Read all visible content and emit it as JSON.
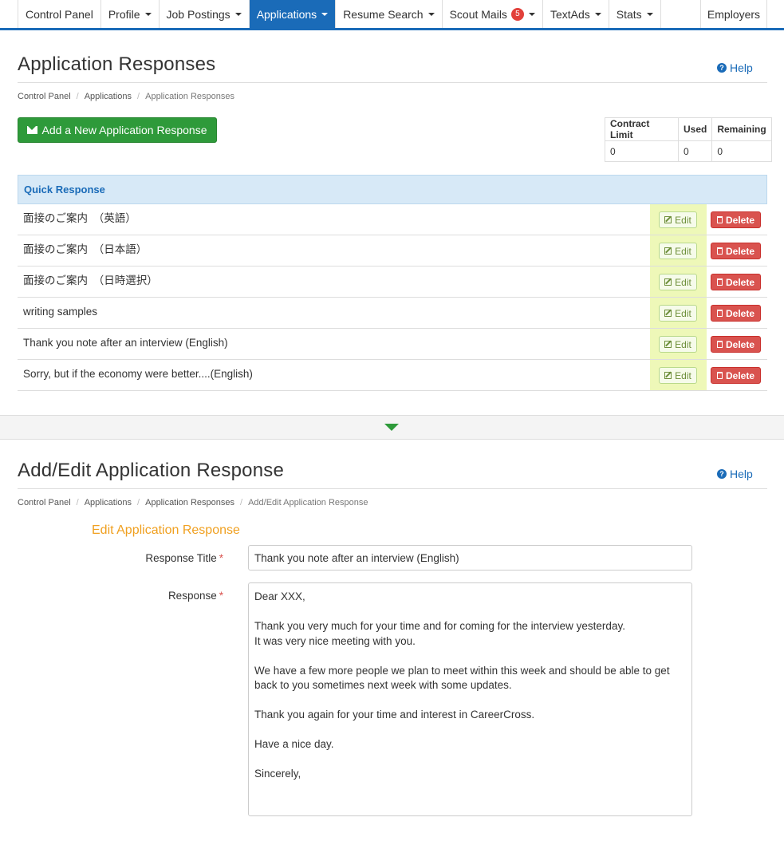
{
  "nav": {
    "items": [
      {
        "label": "Control Panel",
        "caret": false
      },
      {
        "label": "Profile",
        "caret": true
      },
      {
        "label": "Job Postings",
        "caret": true
      },
      {
        "label": "Applications",
        "caret": true,
        "active": true
      },
      {
        "label": "Resume Search",
        "caret": true
      },
      {
        "label": "Scout Mails",
        "caret": true,
        "badge": "5"
      },
      {
        "label": "TextAds",
        "caret": true
      },
      {
        "label": "Stats",
        "caret": true
      }
    ],
    "right_label": "Employers",
    "accent_color": "#1a6bb8"
  },
  "section1": {
    "title": "Application Responses",
    "help_label": "Help",
    "breadcrumb": [
      "Control Panel",
      "Applications",
      "Application Responses"
    ],
    "add_button_label": "Add a New Application Response",
    "contract_table": {
      "headers": [
        "Contract Limit",
        "Used",
        "Remaining"
      ],
      "values": [
        "0",
        "0",
        "0"
      ]
    },
    "quick_response": {
      "header": "Quick Response",
      "edit_label": "Edit",
      "delete_label": "Delete",
      "rows": [
        "面接のご案内　（英語）",
        "面接のご案内　（日本語）",
        "面接のご案内　（日時選択）",
        "writing samples",
        "Thank you note after an interview (English)",
        "Sorry, but if the economy were better....(English)"
      ]
    }
  },
  "section2": {
    "title": "Add/Edit Application Response",
    "help_label": "Help",
    "breadcrumb": [
      "Control Panel",
      "Applications",
      "Application Responses",
      "Add/Edit Application Response"
    ],
    "form_title": "Edit Application Response",
    "response_title_label": "Response Title",
    "response_title_value": "Thank you note after an interview (English)",
    "response_label": "Response",
    "required_mark": "*",
    "response_value": "Dear XXX,\n\nThank you very much for your time and for coming for the interview yesterday.\nIt was very nice meeting with you.\n\nWe have a few more people we plan to meet within this week and should be able to get back to you sometimes next week with some updates.\n\nThank you again for your time and interest in CareerCross.\n\nHave a nice day.\n\nSincerely,"
  }
}
